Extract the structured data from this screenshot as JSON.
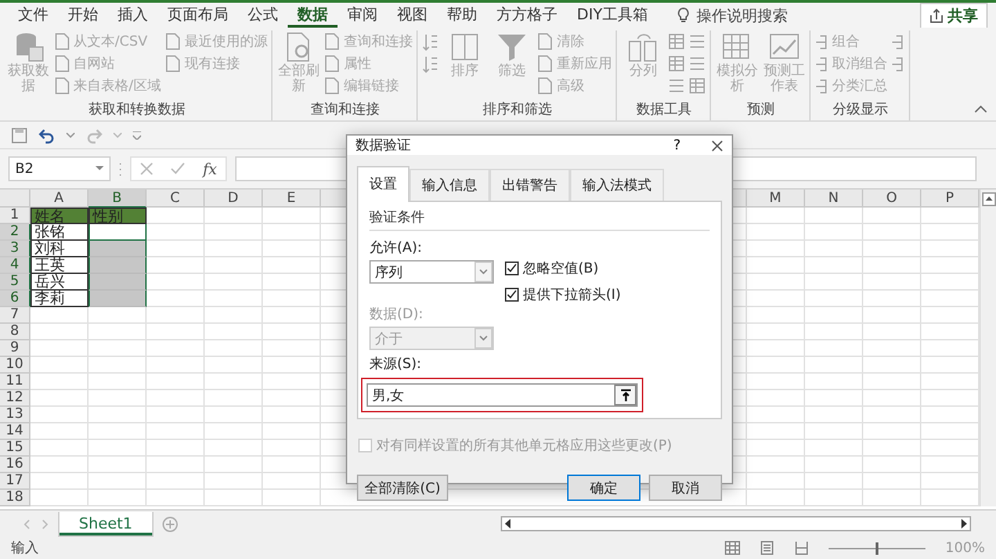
{
  "menu": {
    "tabs": [
      {
        "label": "文件",
        "selected": false
      },
      {
        "label": "开始",
        "selected": false
      },
      {
        "label": "插入",
        "selected": false
      },
      {
        "label": "页面布局",
        "selected": false
      },
      {
        "label": "公式",
        "selected": false
      },
      {
        "label": "数据",
        "selected": true
      },
      {
        "label": "审阅",
        "selected": false
      },
      {
        "label": "视图",
        "selected": false
      },
      {
        "label": "帮助",
        "selected": false
      },
      {
        "label": "方方格子",
        "selected": false
      },
      {
        "label": "DIY工具箱",
        "selected": false
      }
    ],
    "search": {
      "placeholder": "操作说明搜索"
    },
    "share_button": "共享"
  },
  "ribbon": {
    "disabled": true,
    "groups": [
      {
        "label": "获取和转换数据",
        "items": [
          {
            "kind": "large",
            "label": "获取数据"
          },
          {
            "kind": "small",
            "label": "从文本/CSV"
          },
          {
            "kind": "small",
            "label": "自网站"
          },
          {
            "kind": "small",
            "label": "来自表格/区域"
          },
          {
            "kind": "small",
            "label": "最近使用的源"
          },
          {
            "kind": "small",
            "label": "现有连接"
          }
        ]
      },
      {
        "label": "查询和连接",
        "items": [
          {
            "kind": "large",
            "label": "全部刷新"
          },
          {
            "kind": "small",
            "label": "查询和连接"
          },
          {
            "kind": "small",
            "label": "属性"
          },
          {
            "kind": "small",
            "label": "编辑链接"
          }
        ]
      },
      {
        "label": "排序和筛选",
        "items": [
          {
            "kind": "icon"
          },
          {
            "kind": "icon"
          },
          {
            "kind": "large",
            "label": "排序"
          },
          {
            "kind": "large",
            "label": "筛选"
          },
          {
            "kind": "small",
            "label": "清除"
          },
          {
            "kind": "small",
            "label": "重新应用"
          },
          {
            "kind": "small",
            "label": "高级"
          }
        ]
      },
      {
        "label": "数据工具",
        "items": [
          {
            "kind": "large",
            "label": "分列"
          },
          {
            "kind": "icon"
          },
          {
            "kind": "icon"
          },
          {
            "kind": "icon"
          },
          {
            "kind": "icon"
          },
          {
            "kind": "icon"
          },
          {
            "kind": "icon"
          }
        ]
      },
      {
        "label": "预测",
        "items": [
          {
            "kind": "large",
            "label": "模拟分析"
          },
          {
            "kind": "large",
            "label": "预测工作表"
          }
        ]
      },
      {
        "label": "分级显示",
        "items": [
          {
            "kind": "small",
            "label": "组合"
          },
          {
            "kind": "small",
            "label": "取消组合"
          },
          {
            "kind": "small",
            "label": "分类汇总"
          },
          {
            "kind": "icon"
          },
          {
            "kind": "icon"
          }
        ]
      }
    ]
  },
  "formula_bar": {
    "name_box": "B2",
    "function_label": "fx"
  },
  "sheet": {
    "columns": [
      {
        "label": "A",
        "selected": false
      },
      {
        "label": "B",
        "selected": true
      },
      {
        "label": "C",
        "selected": false
      },
      {
        "label": "D",
        "selected": false
      },
      {
        "label": "E",
        "selected": false
      }
    ],
    "columns_right": [
      {
        "label": "M",
        "selected": false
      },
      {
        "label": "N",
        "selected": false
      },
      {
        "label": "O",
        "selected": false
      },
      {
        "label": "P",
        "selected": false
      }
    ],
    "rows": [
      {
        "number": "1",
        "selected": false,
        "cells": [
          {
            "kind": "header",
            "text": "姓名"
          },
          {
            "kind": "header",
            "text": "性别"
          }
        ]
      },
      {
        "number": "2",
        "selected": true,
        "cells": [
          {
            "kind": "plain",
            "text": "张铭"
          },
          {
            "kind": "active"
          }
        ]
      },
      {
        "number": "3",
        "selected": true,
        "cells": [
          {
            "kind": "plain",
            "text": "刘科"
          },
          {
            "kind": "selected"
          }
        ]
      },
      {
        "number": "4",
        "selected": true,
        "cells": [
          {
            "kind": "plain",
            "text": "王英"
          },
          {
            "kind": "selected"
          }
        ]
      },
      {
        "number": "5",
        "selected": true,
        "cells": [
          {
            "kind": "plain",
            "text": "岳兴"
          },
          {
            "kind": "selected"
          }
        ]
      },
      {
        "number": "6",
        "selected": true,
        "cells": [
          {
            "kind": "plain",
            "text": "李莉"
          },
          {
            "kind": "selected"
          }
        ]
      },
      {
        "number": "7",
        "selected": false
      },
      {
        "number": "8",
        "selected": false
      },
      {
        "number": "9",
        "selected": false
      },
      {
        "number": "10",
        "selected": false
      },
      {
        "number": "11",
        "selected": false
      },
      {
        "number": "12",
        "selected": false
      },
      {
        "number": "13",
        "selected": false
      },
      {
        "number": "14",
        "selected": false
      },
      {
        "number": "15",
        "selected": false
      },
      {
        "number": "16",
        "selected": false
      },
      {
        "number": "17",
        "selected": false
      },
      {
        "number": "18",
        "selected": false
      }
    ]
  },
  "sheet_tabs": {
    "tabs": [
      {
        "label": "Sheet1",
        "selected": true
      }
    ]
  },
  "status_bar": {
    "mode": "输入",
    "zoom_slider": {
      "level": 0.5
    },
    "zoom": "100%"
  },
  "dialog": {
    "title": "数据验证",
    "help": "?",
    "tabs": [
      {
        "label": "设置",
        "selected": true
      },
      {
        "label": "输入信息",
        "selected": false
      },
      {
        "label": "出错警告",
        "selected": false
      },
      {
        "label": "输入法模式",
        "selected": false
      }
    ],
    "section_label": "验证条件",
    "allow": {
      "label": "允许(A):",
      "value": "序列",
      "disabled": false
    },
    "checkboxes": [
      {
        "label": "忽略空值(B)",
        "checked": true,
        "disabled": false
      },
      {
        "label": "提供下拉箭头(I)",
        "checked": true,
        "disabled": false
      }
    ],
    "data": {
      "label": "数据(D):",
      "value": "介于",
      "disabled": true
    },
    "source": {
      "label": "来源(S):",
      "value": "男,女",
      "highlighted": true
    },
    "apply_all": {
      "label": "对有同样设置的所有其他单元格应用这些更改(P)",
      "checked": false,
      "disabled": true
    },
    "buttons": [
      {
        "label": "全部清除(C)",
        "kind": "left"
      },
      {
        "label": "确定",
        "kind": "default"
      },
      {
        "label": "取消",
        "kind": "normal"
      }
    ]
  }
}
